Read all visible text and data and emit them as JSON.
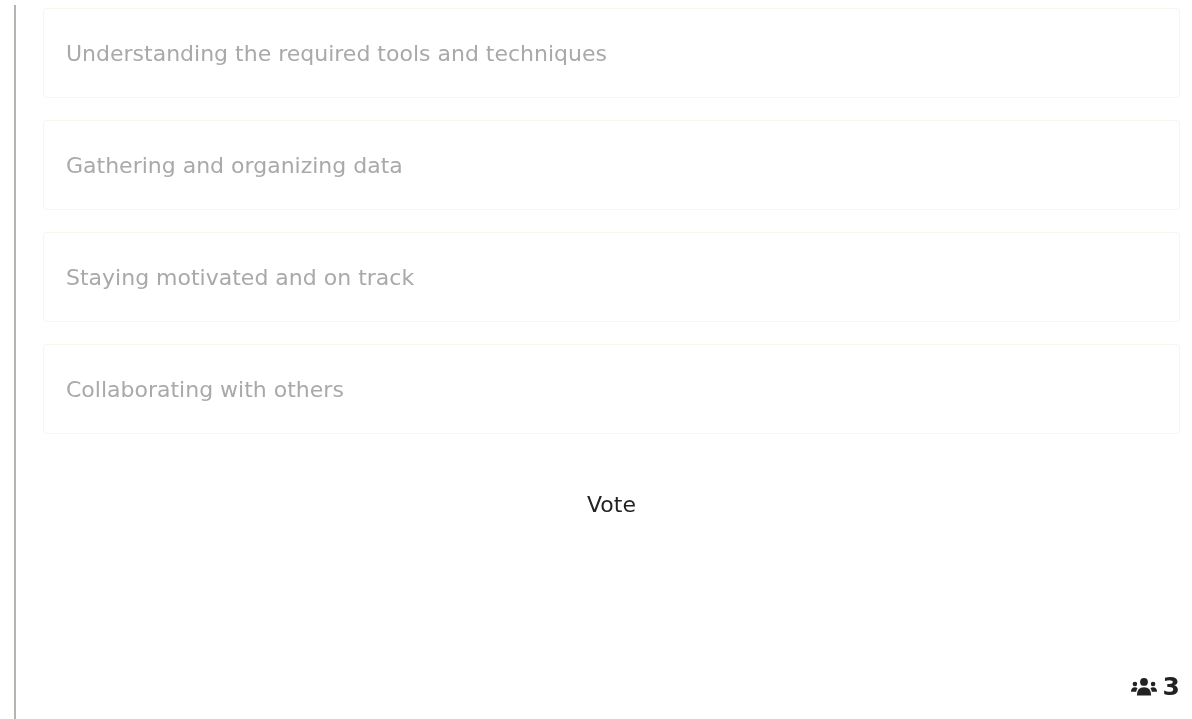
{
  "options": [
    {
      "label": "Understanding the required tools and techniques"
    },
    {
      "label": "Gathering and organizing data"
    },
    {
      "label": "Staying motivated and on track"
    },
    {
      "label": "Collaborating with others"
    }
  ],
  "vote_button": {
    "label": "Vote"
  },
  "participants": {
    "count": "3"
  }
}
